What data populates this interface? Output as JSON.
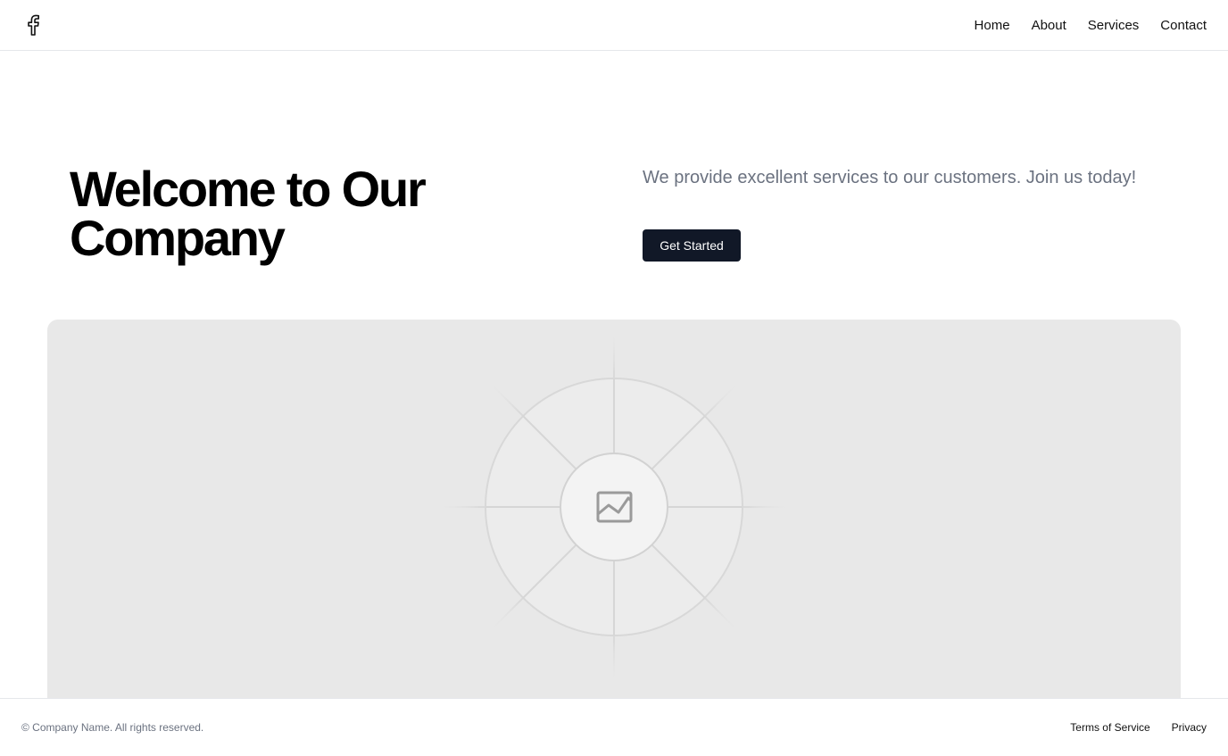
{
  "header": {
    "logo_icon": "facebook-f-icon",
    "nav": [
      {
        "label": "Home"
      },
      {
        "label": "About"
      },
      {
        "label": "Services"
      },
      {
        "label": "Contact"
      }
    ]
  },
  "hero": {
    "title": "Welcome to Our Company",
    "subtitle": "We provide excellent services to our customers. Join us today!",
    "cta_label": "Get Started",
    "image_icon": "image-placeholder-icon"
  },
  "footer": {
    "copyright": "© Company Name. All rights reserved.",
    "links": [
      {
        "label": "Terms of Service"
      },
      {
        "label": "Privacy"
      }
    ]
  },
  "colors": {
    "primary_button": "#111827",
    "muted_text": "#6b7280",
    "placeholder_bg": "#e8e8e8"
  }
}
